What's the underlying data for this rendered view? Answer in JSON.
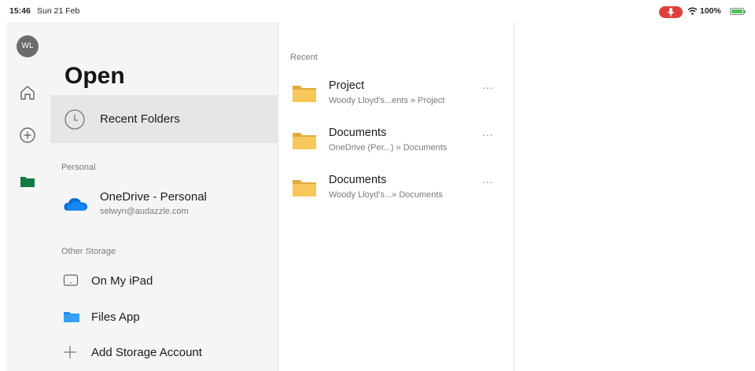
{
  "status_bar": {
    "time": "15:46",
    "date": "Sun 21 Feb",
    "battery": "100%",
    "mic_color": "#e0403a",
    "battery_color": "#4ac25a"
  },
  "rail": {
    "avatar_initials": "WL",
    "items": [
      {
        "icon": "home-icon"
      },
      {
        "icon": "plus-circle-icon"
      },
      {
        "icon": "folder-icon",
        "active": true,
        "color": "#107c41"
      }
    ]
  },
  "nav": {
    "title": "Open",
    "recent_folders": "Recent Folders",
    "personal_label": "Personal",
    "onedrive": {
      "name": "OneDrive - Personal",
      "email": "selwyn@audazzle.com"
    },
    "other_storage_label": "Other Storage",
    "storage_items": [
      {
        "label": "On My iPad",
        "icon": "ipad-icon"
      },
      {
        "label": "Files App",
        "icon": "files-app-folder-icon"
      },
      {
        "label": "Add Storage Account",
        "icon": "plus-icon"
      }
    ]
  },
  "content": {
    "recent_label": "Recent",
    "files": [
      {
        "name": "Project",
        "path": "Woody Lloyd's...ents » Project"
      },
      {
        "name": "Documents",
        "path": "OneDrive (Per...) » Documents"
      },
      {
        "name": "Documents",
        "path": "Woody Lloyd's...» Documents"
      }
    ],
    "more_label": "···"
  }
}
